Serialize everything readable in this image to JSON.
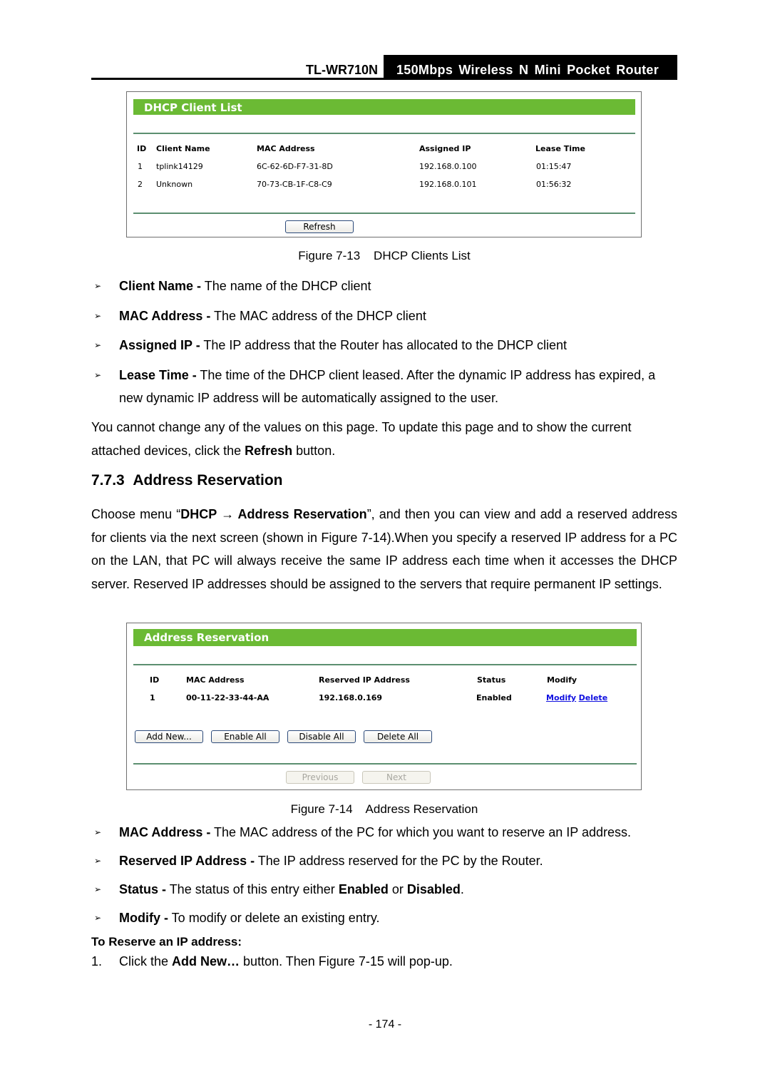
{
  "header": {
    "model": "TL-WR710N",
    "product": "150Mbps  Wireless  N  Mini  Pocket  Router"
  },
  "dhcp_panel": {
    "title": "DHCP Client List",
    "columns": [
      "ID",
      "Client Name",
      "MAC Address",
      "Assigned IP",
      "Lease Time"
    ],
    "rows": [
      [
        "1",
        "tplink14129",
        "6C-62-6D-F7-31-8D",
        "192.168.0.100",
        "01:15:47"
      ],
      [
        "2",
        "Unknown",
        "70-73-CB-1F-C8-C9",
        "192.168.0.101",
        "01:56:32"
      ]
    ],
    "refresh_label": "Refresh"
  },
  "figure13_caption": "Figure 7-13    DHCP Clients List",
  "dhcp_bullets": [
    {
      "term": "Client Name -",
      "text": " The name of the DHCP client"
    },
    {
      "term": "MAC Address -",
      "text": " The MAC address of the DHCP client"
    },
    {
      "term": "Assigned IP -",
      "text": " The IP address that the Router has allocated to the DHCP client"
    },
    {
      "term": "Lease Time -",
      "text": " The time of the DHCP client leased. After the dynamic IP address has expired, a new dynamic IP address will be automatically assigned to the user."
    }
  ],
  "refresh_para": {
    "before": "You cannot change any of the values on this page. To update this page and to show the current attached devices, click the ",
    "bold": "Refresh",
    "after": " button."
  },
  "section": {
    "number": "7.7.3",
    "title": "Address Reservation"
  },
  "intro_para": {
    "p1": "Choose menu “",
    "b1": "DHCP → Address Reservation",
    "p2": "”, and then you can view and add a reserved address for clients via the next screen (shown in Figure 7-14).When you specify a reserved IP address for a PC on the LAN, that PC will always receive the same IP address each time when it accesses the DHCP server. Reserved IP addresses should be assigned to the servers that require permanent IP settings."
  },
  "reservation_panel": {
    "title": "Address Reservation",
    "columns": [
      "ID",
      "MAC Address",
      "Reserved IP Address",
      "Status",
      "Modify"
    ],
    "rows": [
      {
        "id": "1",
        "mac": "00-11-22-33-44-AA",
        "ip": "192.168.0.169",
        "status": "Enabled",
        "modify_link": "Modify",
        "delete_link": "Delete"
      }
    ],
    "buttons": [
      "Add New...",
      "Enable All",
      "Disable All",
      "Delete All"
    ],
    "previous_label": "Previous",
    "next_label": "Next"
  },
  "figure14_caption": "Figure 7-14    Address Reservation",
  "reservation_bullets": [
    {
      "term": "MAC Address -",
      "text": " The MAC address of the PC for which you want to reserve an IP address."
    },
    {
      "term": "Reserved IP Address -",
      "text": " The IP address reserved for the PC by the Router."
    },
    {
      "term": "Status -",
      "text": " The status of this entry either ",
      "b2": "Enabled",
      "mid": " or ",
      "b3": "Disabled",
      "end": "."
    },
    {
      "term": "Modify -",
      "text": " To modify or delete an existing entry."
    }
  ],
  "reserve_heading": "To Reserve an IP address:",
  "step1": {
    "num": "1.",
    "before": "Click the ",
    "bold": "Add New…",
    "after": " button. Then Figure 7-15 will pop-up."
  },
  "bullet_glyph": "➢",
  "page_number": "- 174 -"
}
